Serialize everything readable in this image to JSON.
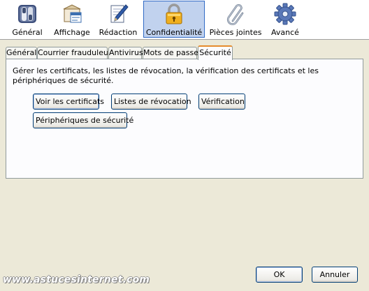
{
  "toolbar": {
    "items": [
      {
        "label": "Général",
        "icon": "general-switch-icon"
      },
      {
        "label": "Affichage",
        "icon": "display-window-icon"
      },
      {
        "label": "Rédaction",
        "icon": "compose-pen-icon"
      },
      {
        "label": "Confidentialité",
        "icon": "padlock-icon",
        "selected": true
      },
      {
        "label": "Pièces jointes",
        "icon": "paperclip-icon"
      },
      {
        "label": "Avancé",
        "icon": "gear-icon"
      }
    ]
  },
  "tabs": [
    {
      "label": "Général"
    },
    {
      "label": "Courrier frauduleux"
    },
    {
      "label": "Antivirus"
    },
    {
      "label": "Mots de passe"
    },
    {
      "label": "Sécurité",
      "active": true
    }
  ],
  "panel": {
    "description": "Gérer les certificats, les listes de révocation, la vérification des certificats et les périphériques de sécurité.",
    "buttons": {
      "view_certs": "Voir les certificats",
      "revocation": "Listes de révocation",
      "verification": "Vérification",
      "devices": "Périphériques de sécurité"
    }
  },
  "footer": {
    "ok": "OK",
    "cancel": "Annuler"
  },
  "watermark": "www.astucesinternet.com",
  "colors": {
    "window_bg": "#ece9d8",
    "selected_bg": "#c1d2ee",
    "selected_border": "#316ac5",
    "active_tab_accent": "#e68b2c",
    "button_border": "#003c74"
  }
}
